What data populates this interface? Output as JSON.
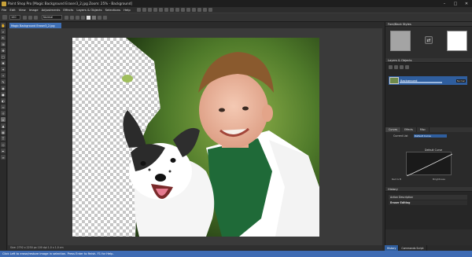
{
  "window": {
    "title": "Paint Shop Pro [Magic Background Eraser3_2.jpg Zoom: 25% - Background]"
  },
  "menu": [
    "File",
    "Edit",
    "View",
    "Image",
    "Adjustments",
    "Effects",
    "Layers & Objects",
    "Selections",
    "Help"
  ],
  "options": {
    "size": "100",
    "mode": "Normal"
  },
  "document": {
    "tab_label": "Magic Background Eraser3_2.jpg"
  },
  "doc_status": "Size: 2792 x 2250 px  100 dpi  1.0 x 1.0 cm",
  "panels": {
    "fb_styles": "Fore/Back Styles",
    "layers": "Layers & Objects",
    "layer_name": "Background",
    "layer_mode": "Normal",
    "tabs": [
      "Curves",
      "Effects",
      "Misc"
    ],
    "current_list_label": "Current List",
    "current_list_value": "Default Curve",
    "curve_title": "Default Curve",
    "axis_x": "Red  G  B",
    "axis_y": "Brightness",
    "history": "History",
    "history_header": "Action Description",
    "history_item": "Eraser Editing"
  },
  "bottom_tabs": [
    "History",
    "Commands Script"
  ],
  "status_text": "Click Left to erase/restore image in selection. Press Enter to finish. F1 for Help."
}
